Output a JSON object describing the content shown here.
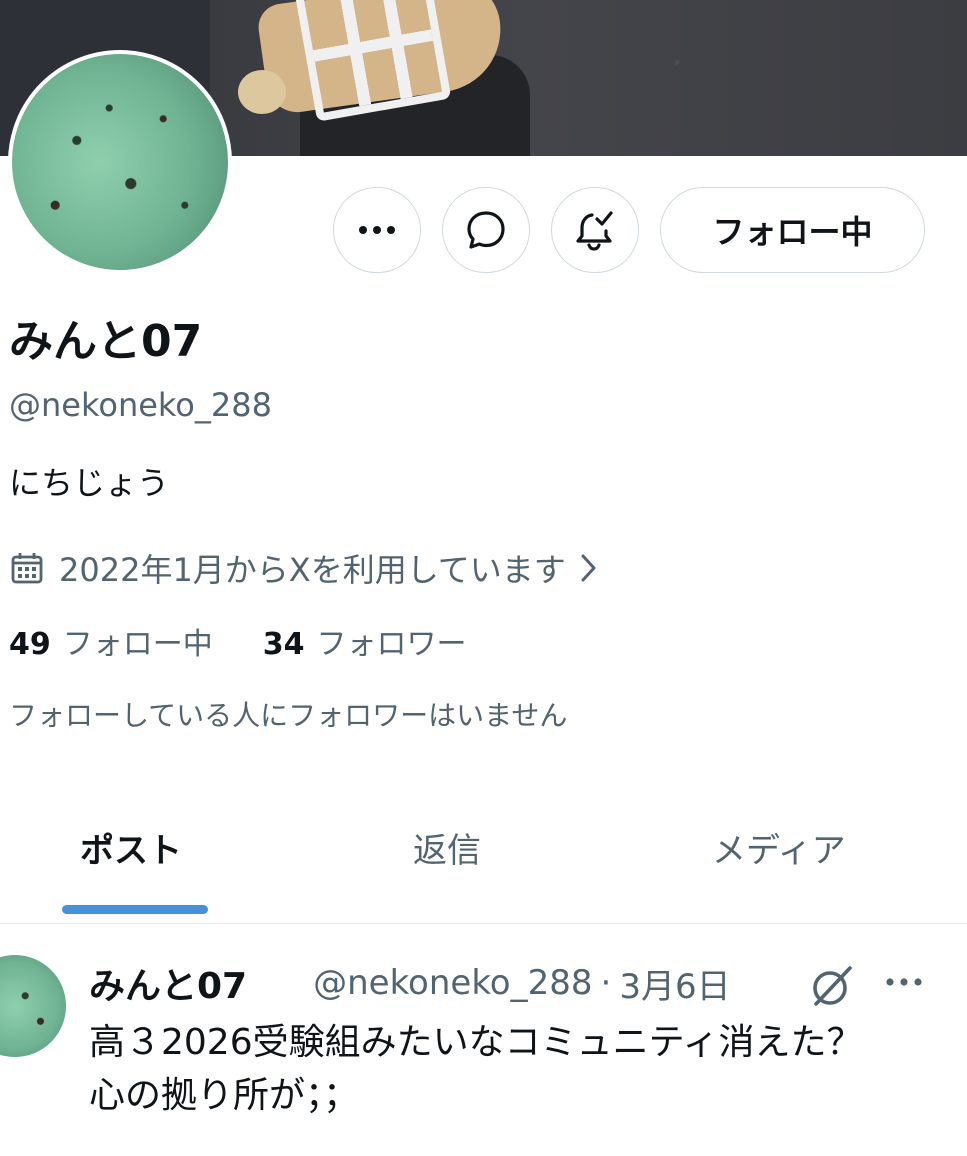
{
  "profile": {
    "display_name": "みんと07",
    "handle": "@nekoneko_288",
    "bio": "にちじょう",
    "joined": "2022年1月からXを利用しています",
    "following_count": "49",
    "following_label": "フォロー中",
    "followers_count": "34",
    "followers_label": "フォロワー",
    "mutual_note": "フォローしている人にフォロワーはいません"
  },
  "actions": {
    "follow_label": "フォロー中"
  },
  "tabs": [
    {
      "label": "ポスト",
      "active": true
    },
    {
      "label": "返信",
      "active": false
    },
    {
      "label": "メディア",
      "active": false
    }
  ],
  "post": {
    "display_name": "みんと07",
    "handle": "@nekoneko_288",
    "separator": "·",
    "date": "3月6日",
    "text_lines": [
      "高３2026受験組みたいなコミュニティ消えた？",
      "心の拠り所が；；"
    ]
  },
  "icons": {
    "more": "more-horizontal-icon",
    "message": "message-icon",
    "notification": "bell-check-icon",
    "calendar": "calendar-icon",
    "chevron": "chevron-right-icon",
    "grok": "grok-icon"
  },
  "colors": {
    "accent": "#4a90d9",
    "text_primary": "#0f1419",
    "text_secondary": "#536471",
    "border": "#cfd9de"
  }
}
